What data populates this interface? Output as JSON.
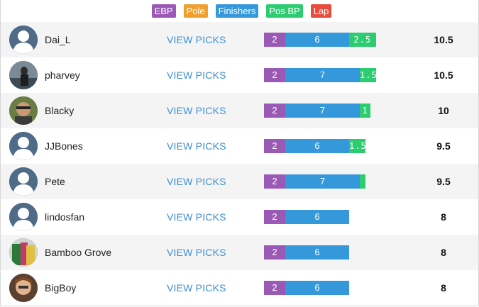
{
  "legend": [
    {
      "label": "EBP",
      "color": "#9b59b6"
    },
    {
      "label": "Pole",
      "color": "#f0a030"
    },
    {
      "label": "Finishers",
      "color": "#3498db"
    },
    {
      "label": "Pos BP",
      "color": "#2ecc71"
    },
    {
      "label": "Lap",
      "color": "#e74c3c"
    }
  ],
  "view_picks_label": "VIEW PICKS",
  "rows": [
    {
      "name": "Dai_L",
      "avatar": "default-avatar-icon",
      "ebp": "2",
      "finishers": "6",
      "pos_bp": "2.5",
      "total": "10.5"
    },
    {
      "name": "pharvey",
      "avatar": "user-photo-avatar",
      "ebp": "2",
      "finishers": "7",
      "pos_bp": "1.5",
      "total": "10.5"
    },
    {
      "name": "Blacky",
      "avatar": "user-photo-avatar",
      "ebp": "2",
      "finishers": "7",
      "pos_bp": "1",
      "total": "10"
    },
    {
      "name": "JJBones",
      "avatar": "default-avatar-icon",
      "ebp": "2",
      "finishers": "6",
      "pos_bp": "1.5",
      "total": "9.5"
    },
    {
      "name": "Pete",
      "avatar": "default-avatar-icon",
      "ebp": "2",
      "finishers": "7",
      "pos_bp": "0.5",
      "total": "9.5"
    },
    {
      "name": "lindosfan",
      "avatar": "default-avatar-icon",
      "ebp": "2",
      "finishers": "6",
      "pos_bp": "",
      "total": "8"
    },
    {
      "name": "Bamboo Grove",
      "avatar": "user-photo-avatar",
      "ebp": "2",
      "finishers": "6",
      "pos_bp": "",
      "total": "8"
    },
    {
      "name": "BigBoy",
      "avatar": "user-photo-avatar",
      "ebp": "2",
      "finishers": "6",
      "pos_bp": "",
      "total": "8"
    }
  ]
}
